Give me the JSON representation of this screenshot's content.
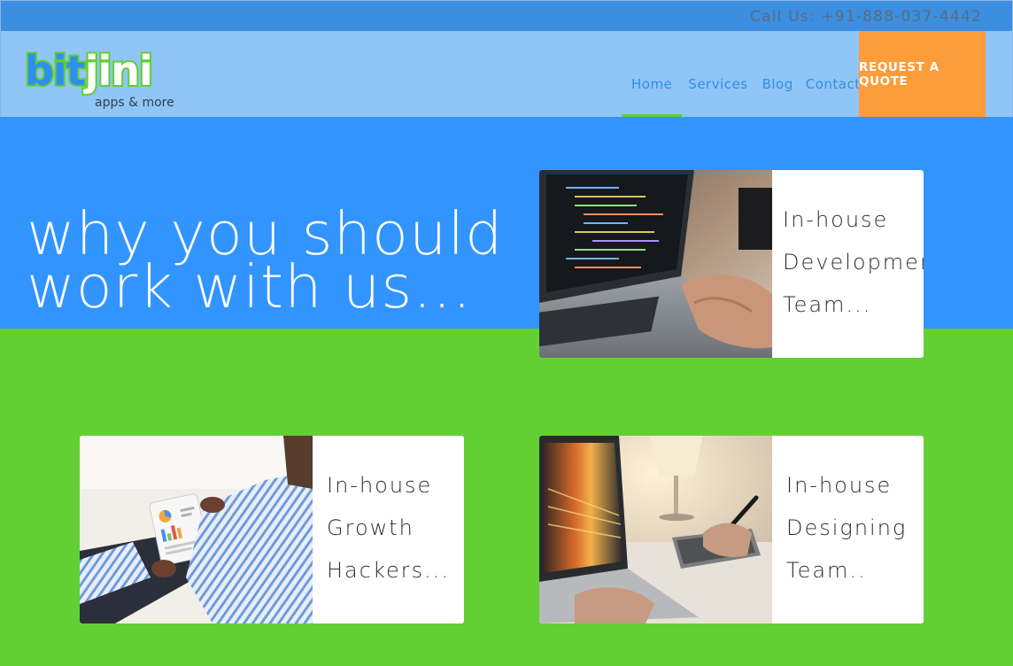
{
  "topbar": {
    "phone": "Call Us: +91-888-037-4442"
  },
  "logo": {
    "word_part1": "bit",
    "word_part2": "jini",
    "tagline": "apps & more"
  },
  "nav": {
    "items": [
      {
        "label": "Home"
      },
      {
        "label": "Services"
      },
      {
        "label": "Blog"
      },
      {
        "label": "Contact"
      }
    ],
    "cta": "REQUEST A QUOTE"
  },
  "hero": {
    "line1": "why you should",
    "line2": "work with us..."
  },
  "cards": [
    {
      "lines": [
        "In-house",
        "Development",
        "Team..."
      ],
      "image": "laptop-coding-photo"
    },
    {
      "lines": [
        "In-house",
        "Growth",
        "Hackers..."
      ],
      "image": "tablet-analytics-photo"
    },
    {
      "lines": [
        "In-house",
        "Designing",
        "Team.."
      ],
      "image": "laptop-design-tablet-photo"
    }
  ],
  "colors": {
    "topbar": "#3c8ee0",
    "navbar": "#90c5f8",
    "hero": "#3294ff",
    "green": "#62d033",
    "cta": "#fc9c3a"
  }
}
